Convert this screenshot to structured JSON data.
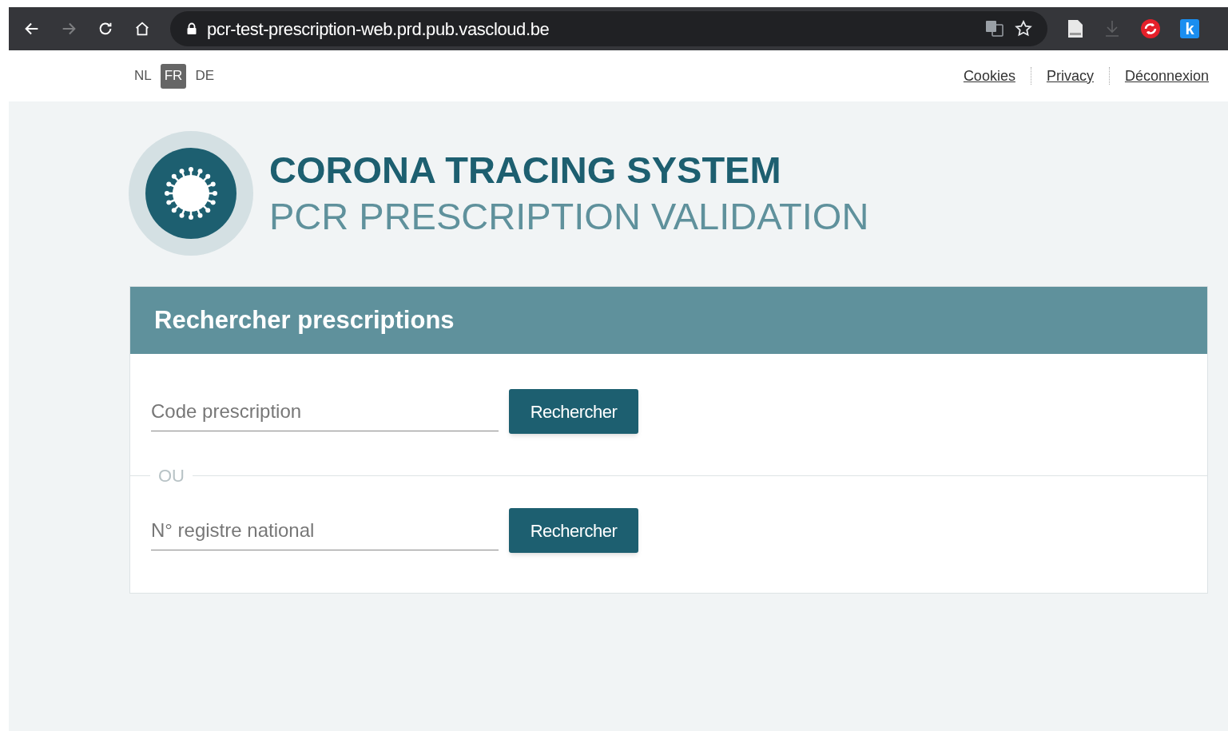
{
  "browser": {
    "url": "pcr-test-prescription-web.prd.pub.vascloud.be",
    "back_disabled": false,
    "forward_disabled": true,
    "download_disabled": true,
    "extension_letter": "k"
  },
  "languages": [
    {
      "label": "NL",
      "selected": false
    },
    {
      "label": "FR",
      "selected": true
    },
    {
      "label": "DE",
      "selected": false
    }
  ],
  "header_links": [
    "Cookies",
    "Privacy",
    "Déconnexion"
  ],
  "title": "CORONA TRACING SYSTEM",
  "subtitle": "PCR PRESCRIPTION VALIDATION",
  "panel": {
    "title": "Rechercher prescriptions",
    "searches": [
      {
        "placeholder": "Code prescription",
        "button": "Rechercher"
      },
      {
        "placeholder": "N° registre national",
        "button": "Rechercher"
      }
    ],
    "separator": "OU"
  }
}
